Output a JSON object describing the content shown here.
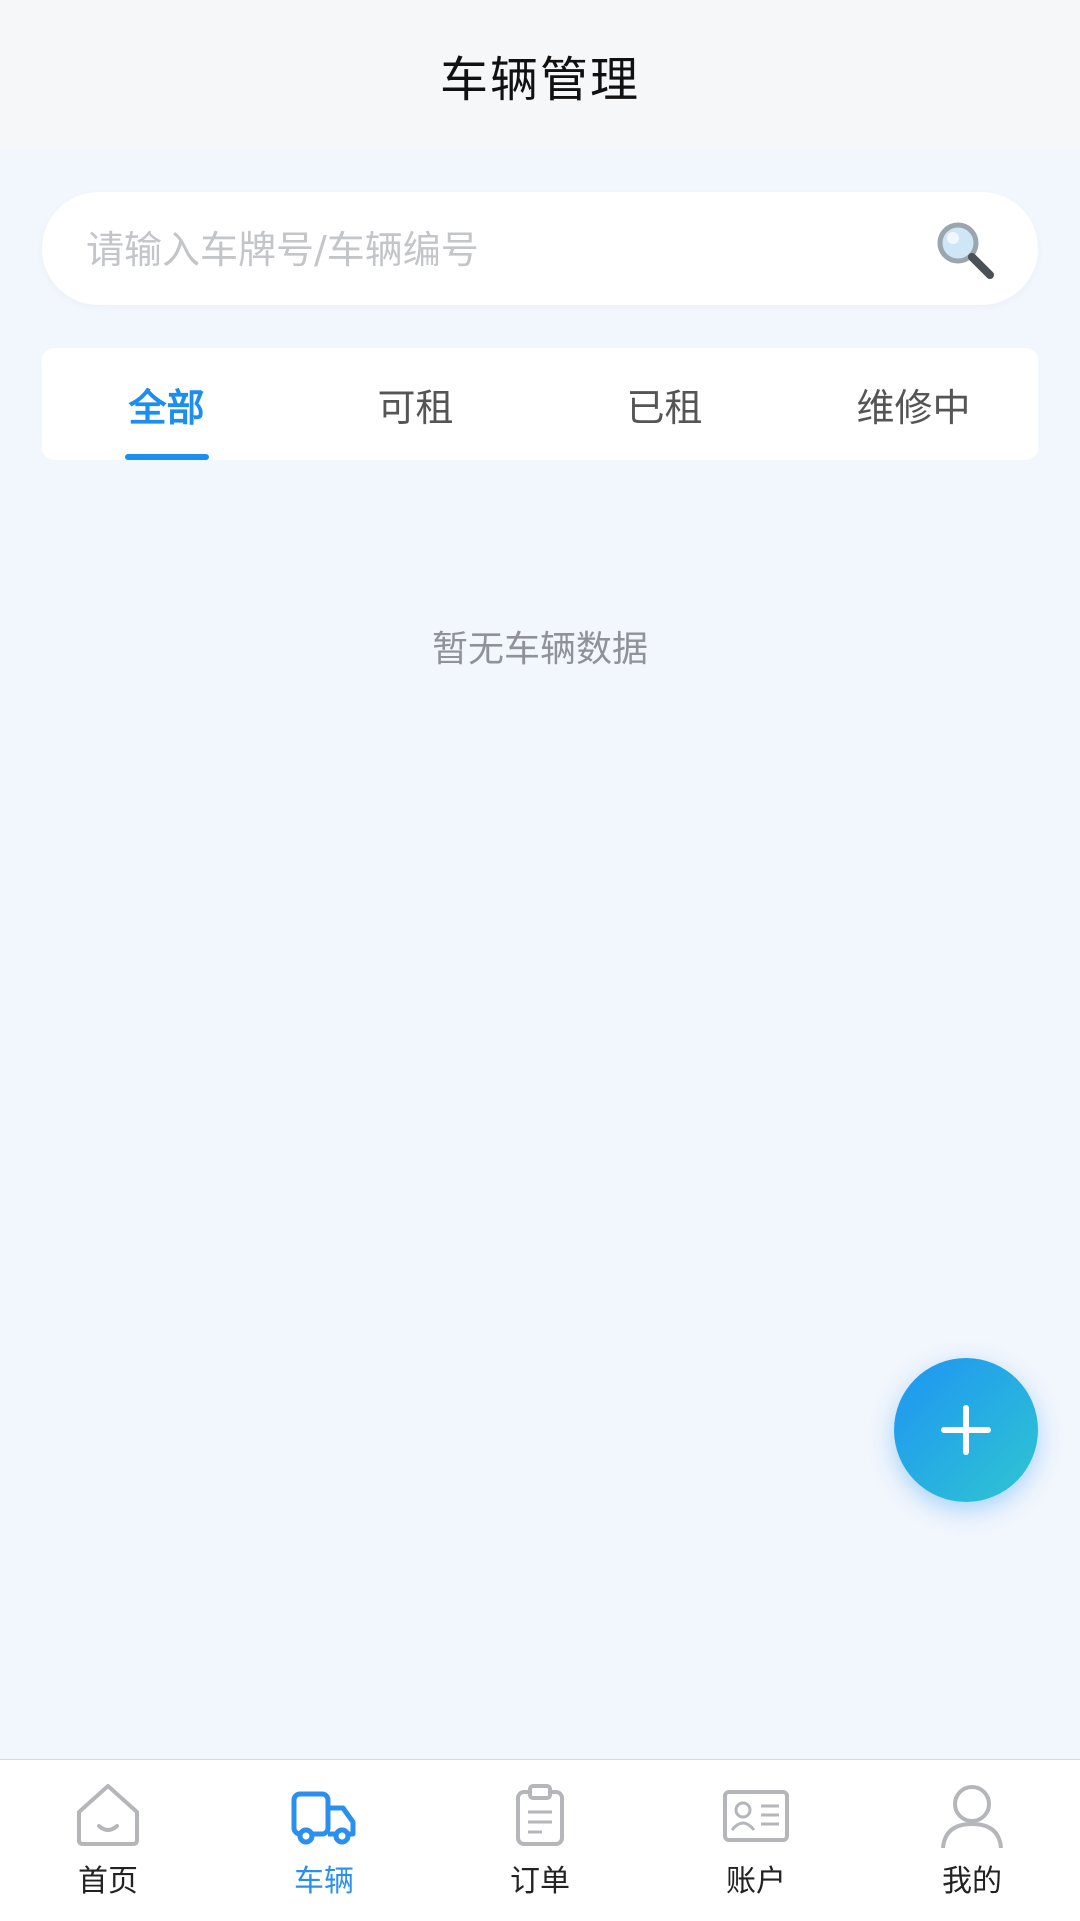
{
  "header": {
    "title": "车辆管理"
  },
  "search": {
    "placeholder": "请输入车牌号/车辆编号",
    "value": ""
  },
  "tabs": [
    {
      "label": "全部",
      "active": true
    },
    {
      "label": "可租",
      "active": false
    },
    {
      "label": "已租",
      "active": false
    },
    {
      "label": "维修中",
      "active": false
    }
  ],
  "empty_state": {
    "text": "暂无车辆数据"
  },
  "fab": {
    "icon": "plus-icon"
  },
  "tabbar": {
    "items": [
      {
        "label": "首页",
        "icon": "home-icon",
        "active": false
      },
      {
        "label": "车辆",
        "icon": "truck-icon",
        "active": true
      },
      {
        "label": "订单",
        "icon": "clipboard-icon",
        "active": false
      },
      {
        "label": "账户",
        "icon": "id-card-icon",
        "active": false
      },
      {
        "label": "我的",
        "icon": "user-icon",
        "active": false
      }
    ]
  },
  "colors": {
    "accent": "#1b8ef0",
    "background": "#f2f6fd",
    "fab_gradient_start": "#1e94f4",
    "fab_gradient_end": "#2fc6d1",
    "inactive_icon": "#b4b6ba"
  }
}
